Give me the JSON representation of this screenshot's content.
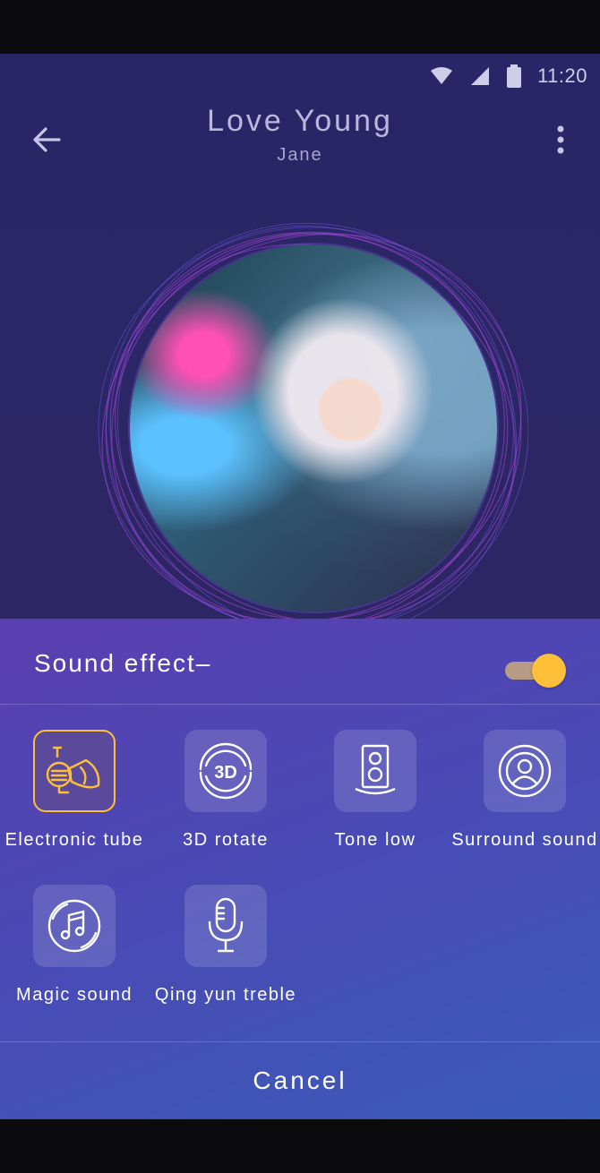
{
  "status_bar": {
    "time": "11:20",
    "icons": [
      "wifi-icon",
      "signal-icon",
      "battery-icon"
    ]
  },
  "header": {
    "title": "Love Young",
    "artist": "Jane",
    "back_icon": "arrow-left-icon",
    "more_icon": "more-vertical-icon"
  },
  "sound_sheet": {
    "title": "Sound effect–",
    "enabled": true,
    "effects": [
      {
        "label": "Electronic tube",
        "icon": "horn-icon",
        "selected": true
      },
      {
        "label": "3D rotate",
        "icon": "3d-rotate-icon",
        "selected": false
      },
      {
        "label": "Tone low",
        "icon": "speaker-icon",
        "selected": false
      },
      {
        "label": "Surround sound",
        "icon": "surround-icon",
        "selected": false
      },
      {
        "label": "Magic sound",
        "icon": "music-disc-icon",
        "selected": false
      },
      {
        "label": "Qing yun treble",
        "icon": "microphone-icon",
        "selected": false
      }
    ],
    "cancel_label": "Cancel"
  },
  "colors": {
    "accent": "#ffbf38",
    "background": "#2a2566",
    "sheet_start": "#5a3fb0",
    "sheet_end": "#3b5bb8"
  }
}
